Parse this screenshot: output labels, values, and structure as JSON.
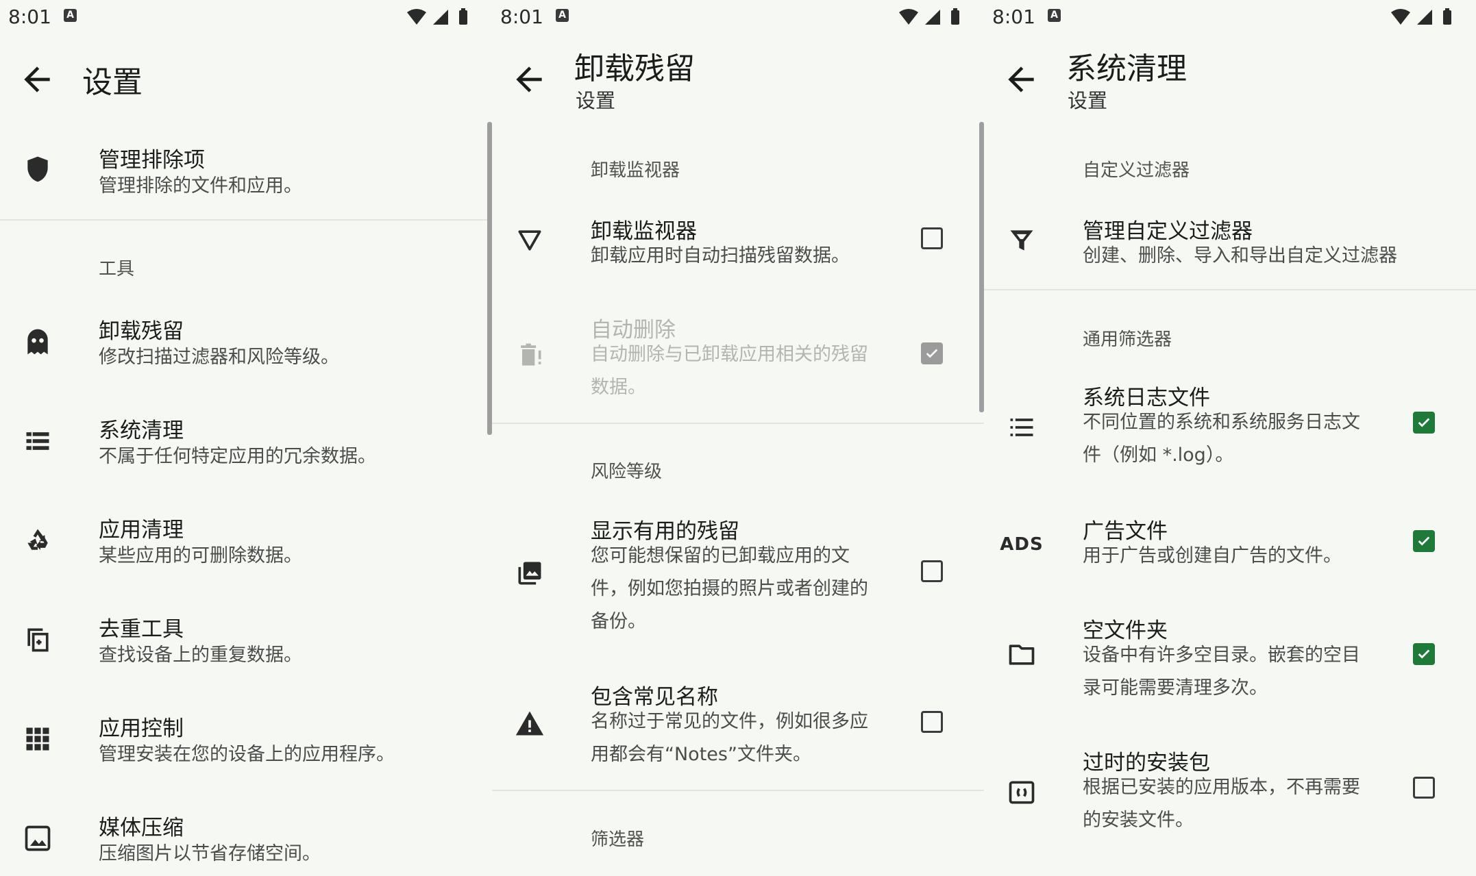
{
  "status": {
    "time": "8:01"
  },
  "panel1": {
    "title": "设置",
    "items": [
      {
        "title": "管理排除项",
        "desc": "管理排除的文件和应用。",
        "icon": "shield-icon"
      },
      {
        "title": "卸载残留",
        "desc": "修改扫描过滤器和风险等级。",
        "icon": "ghost-icon"
      },
      {
        "title": "系统清理",
        "desc": "不属于任何特定应用的冗余数据。",
        "icon": "list-icon"
      },
      {
        "title": "应用清理",
        "desc": "某些应用的可删除数据。",
        "icon": "recycle-icon"
      },
      {
        "title": "去重工具",
        "desc": "查找设备上的重复数据。",
        "icon": "duplicate-icon"
      },
      {
        "title": "应用控制",
        "desc": "管理安装在您的设备上的应用程序。",
        "icon": "apps-grid-icon"
      },
      {
        "title": "媒体压缩",
        "desc": "压缩图片以节省存储空间。",
        "icon": "image-icon"
      }
    ],
    "section_tools": "工具"
  },
  "panel2": {
    "title": "卸载残留",
    "subtitle": "设置",
    "section_monitor": "卸载监视器",
    "section_risk": "风险等级",
    "section_filters": "筛选器",
    "items": [
      {
        "title": "卸载监视器",
        "desc": "卸载应用时自动扫描残留数据。",
        "checked": false,
        "icon": "filter-outline-icon"
      },
      {
        "title": "自动删除",
        "desc": "自动删除与已卸载应用相关的残留数据。",
        "checked": true,
        "disabled": true,
        "icon": "trash-icon"
      },
      {
        "title": "显示有用的残留",
        "desc": "您可能想保留的已卸载应用的文件，例如您拍摄的照片或者创建的备份。",
        "checked": false,
        "icon": "photos-icon"
      },
      {
        "title": "包含常见名称",
        "desc": "名称过于常见的文件，例如很多应用都会有“Notes”文件夹。",
        "checked": false,
        "icon": "warning-icon"
      }
    ]
  },
  "panel3": {
    "title": "系统清理",
    "subtitle": "设置",
    "section_custom": "自定义过滤器",
    "section_general": "通用筛选器",
    "items": [
      {
        "title": "管理自定义过滤器",
        "desc": "创建、删除、导入和导出自定义过滤器",
        "icon": "filter-icon"
      },
      {
        "title": "系统日志文件",
        "desc": "不同位置的系统和系统服务日志文件（例如 *.log）。",
        "checked": true,
        "icon": "list-bullets-icon"
      },
      {
        "title": "广告文件",
        "desc": "用于广告或创建自广告的文件。",
        "checked": true,
        "icon": "ads-icon",
        "icon_text": "ADS"
      },
      {
        "title": "空文件夹",
        "desc": "设备中有许多空目录。嵌套的空目录可能需要清理多次。",
        "checked": true,
        "icon": "folder-icon"
      },
      {
        "title": "过时的安装包",
        "desc": "根据已安装的应用版本，不再需要的安装文件。",
        "checked": false,
        "icon": "apk-icon"
      }
    ]
  },
  "colors": {
    "background": "#f6f8f3",
    "accent": "#1f7a3a",
    "divider": "#e3e5df"
  }
}
